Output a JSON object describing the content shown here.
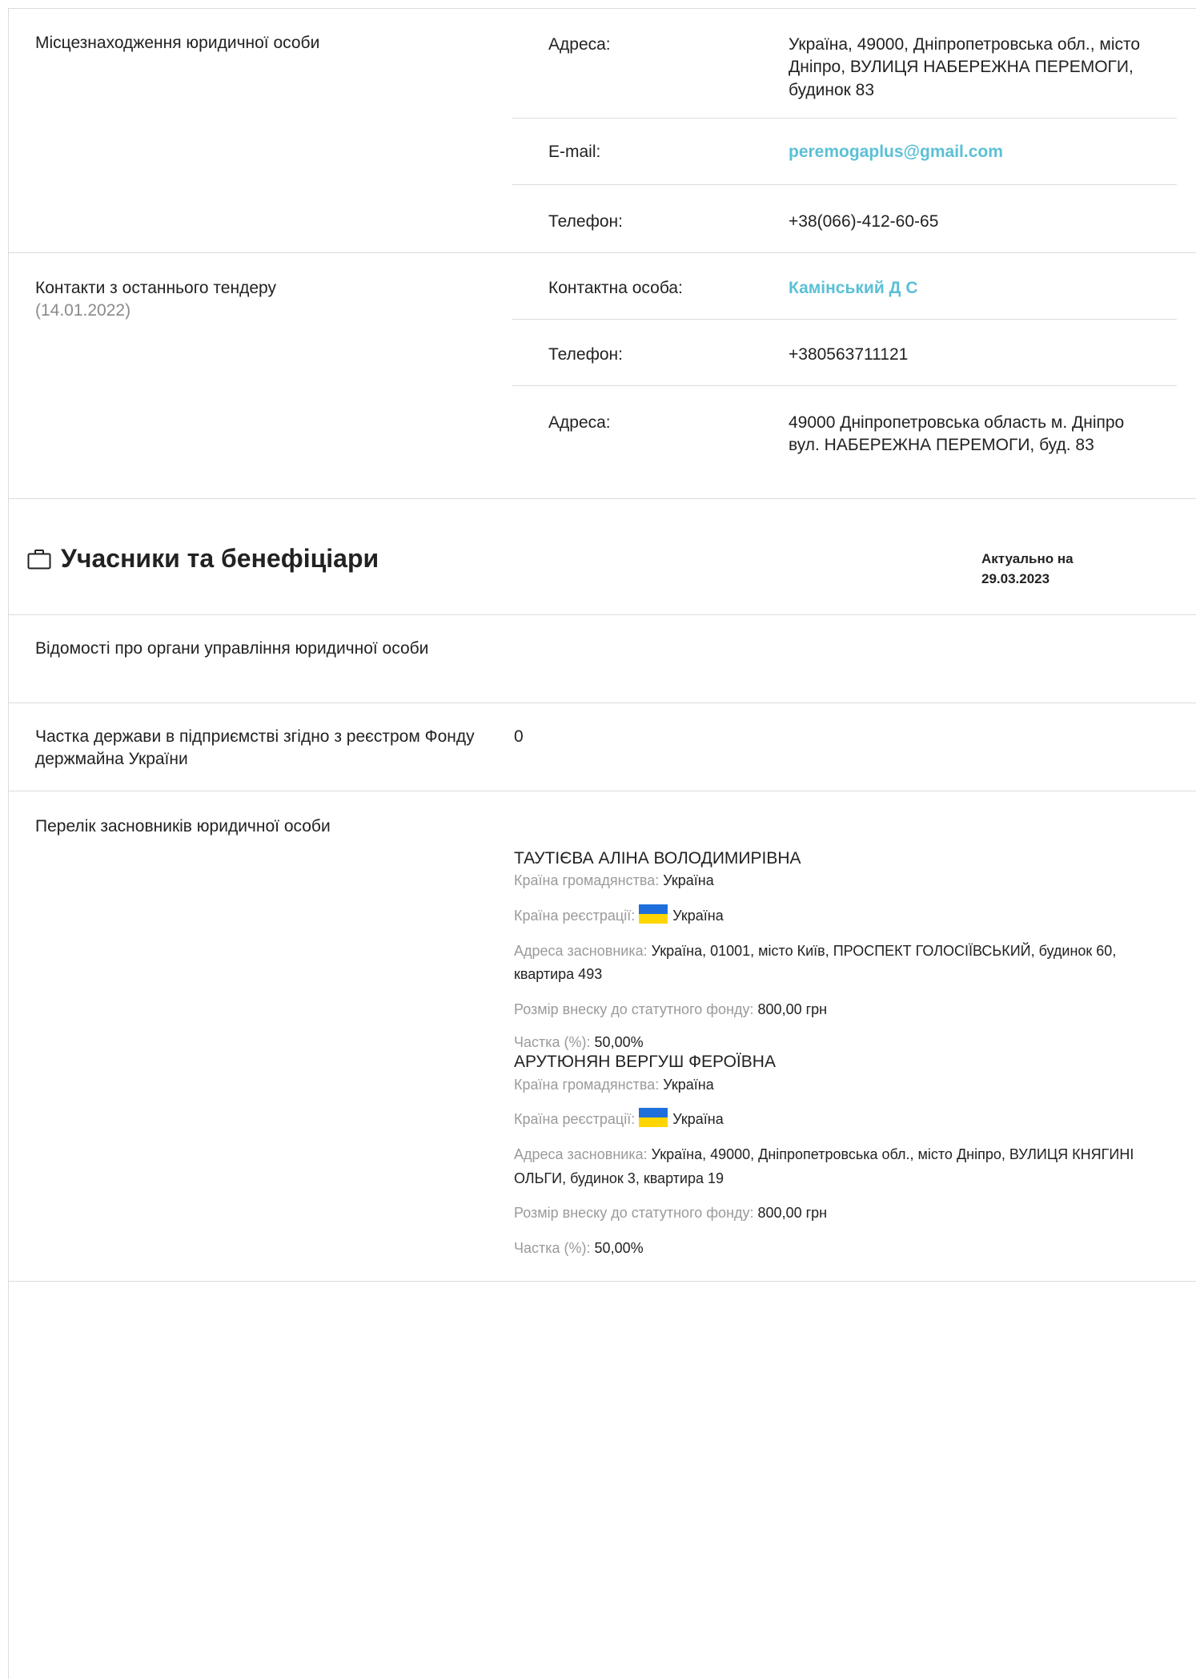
{
  "location": {
    "label": "Місцезнаходження юридичної особи",
    "rows": [
      {
        "key": "Адреса:",
        "value": "Україна, 49000, Дніпропетровська обл., місто Дніпро, ВУЛИЦЯ НАБЕРЕЖНА ПЕРЕМОГИ, будинок 83"
      },
      {
        "key": "E-mail:",
        "value": "peremogaplus@gmail.com"
      },
      {
        "key": "Телефон:",
        "value": "+38(066)-412-60-65"
      }
    ]
  },
  "tender_contacts": {
    "label": "Контакти з останнього тендеру",
    "date": "(14.01.2022)",
    "rows": [
      {
        "key": "Контактна особа:",
        "value": "Камінський Д С"
      },
      {
        "key": "Телефон:",
        "value": "+380563711121"
      },
      {
        "key": "Адреса:",
        "value": "49000 Дніпропетровська область м. Дніпро вул. НАБЕРЕЖНА ПЕРЕМОГИ, буд. 83"
      }
    ]
  },
  "participants": {
    "title": "Учасники та бенефіціари",
    "actual_label": "Актуально на",
    "actual_date": "29.03.2023"
  },
  "governance": {
    "label": "Відомості про органи управління юридичної особи"
  },
  "state_share": {
    "label": "Частка держави в підприємстві згідно з реєстром Фонду держмайна України",
    "value": "0"
  },
  "founders": {
    "label": "Перелік засновників юридичної особи",
    "citizenship_label": "Країна громадянства:",
    "registration_label": "Країна реєстрації:",
    "address_label": "Адреса засновника:",
    "contribution_label": "Розмір внеску до статутного фонду:",
    "share_label": "Частка (%):",
    "items": [
      {
        "name": "ТАУТІЄВА АЛІНА ВОЛОДИМИРІВНА",
        "citizenship": "Україна",
        "registration": "Україна",
        "address": "Україна, 01001, місто Київ, ПРОСПЕКТ ГОЛОСІЇВСЬКИЙ, будинок 60, квартира 493",
        "contribution": "800,00 грн",
        "share": "50,00%"
      },
      {
        "name": "АРУТЮНЯН ВЕРГУШ ФЕРОЇВНА",
        "citizenship": "Україна",
        "registration": "Україна",
        "address": "Україна, 49000, Дніпропетровська обл., місто Дніпро, ВУЛИЦЯ КНЯГИНІ ОЛЬГИ, будинок 3, квартира 19",
        "contribution": "800,00 грн",
        "share": "50,00%"
      }
    ]
  },
  "colors": {
    "link": "#5bc0d6",
    "muted": "#9a9a9a",
    "border": "#dcdcdc",
    "flag_blue": "#1e6fdc",
    "flag_yellow": "#ffd500"
  }
}
